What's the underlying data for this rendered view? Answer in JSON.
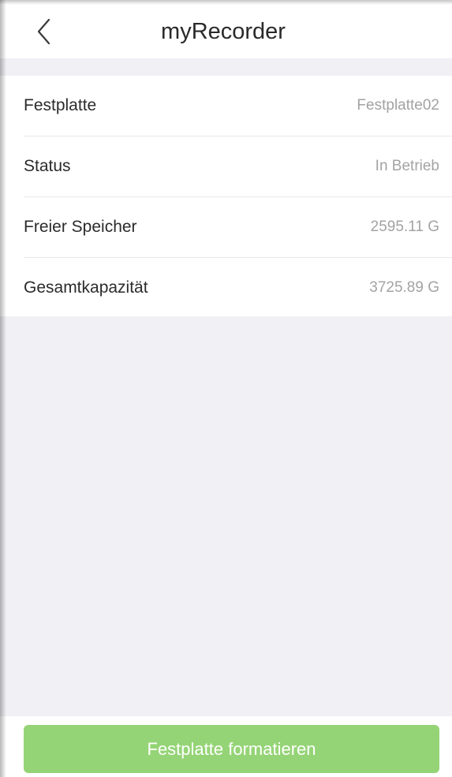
{
  "header": {
    "title": "myRecorder",
    "back_icon": "chevron-left-icon"
  },
  "disk_info": {
    "rows": [
      {
        "label": "Festplatte",
        "value": "Festplatte02"
      },
      {
        "label": "Status",
        "value": "In Betrieb"
      },
      {
        "label": "Freier Speicher",
        "value": "2595.11 G"
      },
      {
        "label": "Gesamtkapazität",
        "value": "3725.89 G"
      }
    ]
  },
  "actions": {
    "format_label": "Festplatte formatieren"
  },
  "colors": {
    "accent": "#95d476",
    "background": "#f0f0f5",
    "value_text": "#a3a3a3"
  }
}
